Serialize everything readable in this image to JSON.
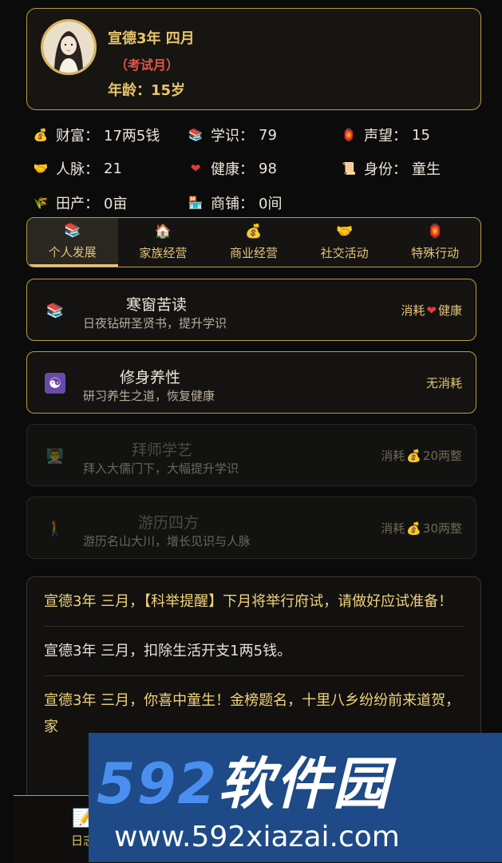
{
  "header": {
    "date": "宣德3年 四月",
    "exam_tag": "（考试月）",
    "age": "年龄：15岁"
  },
  "stats": [
    {
      "icon": "money-bag-icon",
      "label": "财富：",
      "value": "17两5钱"
    },
    {
      "icon": "books-icon",
      "label": "学识：",
      "value": "79"
    },
    {
      "icon": "lantern-icon",
      "label": "声望：",
      "value": "15"
    },
    {
      "icon": "handshake-icon",
      "label": "人脉：",
      "value": "21"
    },
    {
      "icon": "heart-icon",
      "label": "健康：",
      "value": "98"
    },
    {
      "icon": "scroll-icon",
      "label": "身份：",
      "value": "童生"
    },
    {
      "icon": "rice-icon",
      "label": "田产：",
      "value": "0亩"
    },
    {
      "icon": "shop-icon",
      "label": "商铺：",
      "value": "0间"
    }
  ],
  "tabs": [
    {
      "icon": "books-icon",
      "label": "个人发展",
      "active": true
    },
    {
      "icon": "house-icon",
      "label": "家族经营",
      "active": false
    },
    {
      "icon": "money-bag-icon",
      "label": "商业经营",
      "active": false
    },
    {
      "icon": "handshake-icon",
      "label": "社交活动",
      "active": false
    },
    {
      "icon": "lantern-icon",
      "label": "特殊行动",
      "active": false
    }
  ],
  "actions": [
    {
      "icon": "books-icon",
      "title": "寒窗苦读",
      "desc": "日夜钻研圣贤书，提升学识",
      "cost_prefix": "消耗",
      "cost_icon": "heart-icon",
      "cost_text": "健康",
      "enabled": true
    },
    {
      "icon": "yin-yang-icon",
      "title": "修身养性",
      "desc": "研习养生之道，恢复健康",
      "cost_prefix": "无消耗",
      "cost_icon": "",
      "cost_text": "",
      "enabled": true
    },
    {
      "icon": "teacher-icon",
      "title": "拜师学艺",
      "desc": "拜入大儒门下，大幅提升学识",
      "cost_prefix": "消耗",
      "cost_icon": "money-bag-icon",
      "cost_text": "20两整",
      "enabled": false
    },
    {
      "icon": "walking-person-icon",
      "title": "游历四方",
      "desc": "游历名山大川，增长见识与人脉",
      "cost_prefix": "消耗",
      "cost_icon": "money-bag-icon",
      "cost_text": "30两整",
      "enabled": false
    }
  ],
  "log": [
    {
      "text": "宣德3年 三月，【科举提醒】下月将举行府试，请做好应试准备！",
      "highlight": true
    },
    {
      "text": "宣德3年 三月，扣除生活开支1两5钱。",
      "highlight": false
    },
    {
      "text": "宣德3年 三月，你喜中童生！金榜题名，十里八乡纷纷前来道贺，家",
      "highlight": true
    }
  ],
  "bottom_nav": {
    "label": "日志",
    "icon": "notebook-icon"
  },
  "watermark": {
    "brand_num": "592",
    "brand_text": "软件园",
    "url": "www.592xiazai.com"
  },
  "colors": {
    "gold": "#e8c46a",
    "border": "#b99a45",
    "red": "#e0554a",
    "bg": "#0b0b0b"
  }
}
